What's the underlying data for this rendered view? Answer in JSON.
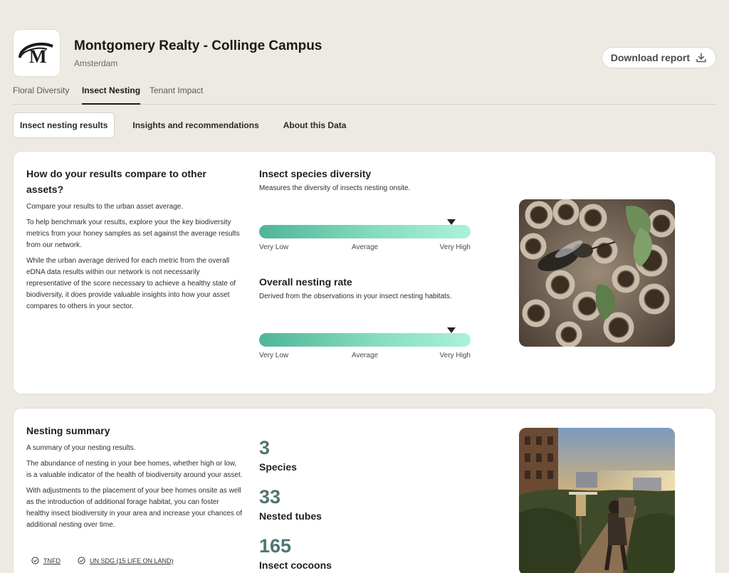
{
  "header": {
    "title": "Montgomery Realty - Collinge Campus",
    "location": "Amsterdam",
    "logo_letter": "M",
    "download_label": "Download report"
  },
  "main_tabs": [
    {
      "label": "Floral Diversity",
      "active": false
    },
    {
      "label": "Insect Nesting",
      "active": true
    },
    {
      "label": "Tenant Impact",
      "active": false
    }
  ],
  "sub_tabs": [
    {
      "label": "Insect nesting results",
      "active": true
    },
    {
      "label": "Insights and recommendations",
      "active": false
    },
    {
      "label": "About this Data",
      "active": false
    }
  ],
  "comparison": {
    "heading": "How do your results compare to other assets?",
    "paragraphs": [
      "Compare your results to the urban asset average.",
      "To help benchmark your results, explore your the key biodiversity metrics from your honey samples as set against the average results from our network.",
      "While the urban average derived for each metric from the overall eDNA data results within our network is not necessarily representative of the score necessary to achieve a healthy state of biodiversity, it does provide valuable insights into how your asset compares to others in your sector."
    ]
  },
  "metrics": [
    {
      "title": "Insect species diversity",
      "description": "Measures the diversity of insects nesting onsite.",
      "level": 0.91,
      "labels": [
        "Very Low",
        "Average",
        "Very High"
      ]
    },
    {
      "title": "Overall nesting rate",
      "description": "Derived from the observations in your insect nesting habitats.",
      "level": 0.91,
      "labels": [
        "Very Low",
        "Average",
        "Very High"
      ]
    }
  ],
  "nesting": {
    "heading": "Nesting summary",
    "paragraphs": [
      "A summary of your nesting results.",
      "The abundance of nesting in your bee homes, whether high or low, is a valuable indicator of the health of biodiversity around your asset.",
      "With adjustments to the placement of your bee homes onsite as well as the introduction of additional forage habitat, you can foster healthy insect biodiversity in your area and increase your chances of additional nesting over time."
    ],
    "stats": [
      {
        "value": "3",
        "label": "Species"
      },
      {
        "value": "33",
        "label": "Nested tubes"
      },
      {
        "value": "165",
        "label": "Insect cocoons"
      }
    ],
    "badges": [
      "TNFD",
      "UN SDG (15 LIFE ON LAND)"
    ]
  },
  "colors": {
    "background": "#ede9e3",
    "accent_teal": "#4f7674",
    "gauge_start": "#4fb598",
    "gauge_end": "#aaf2d8"
  }
}
